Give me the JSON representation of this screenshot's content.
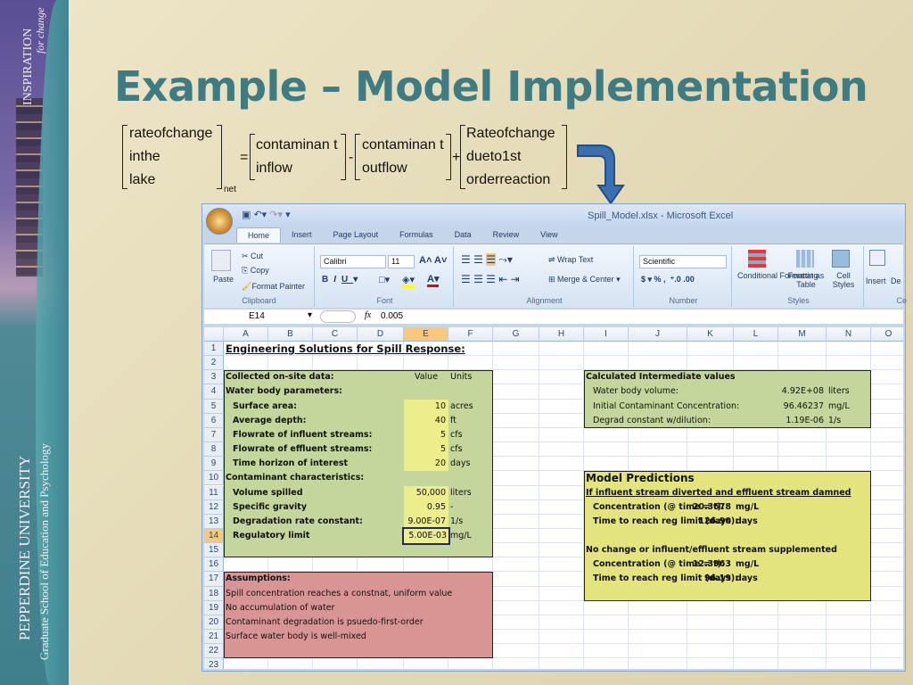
{
  "sidebar": {
    "tagline_main": "INSPIRATION",
    "tagline_sub": "for change",
    "university": "PEPPERDINE UNIVERSITY",
    "school": "Graduate School of Education and Psychology"
  },
  "slide": {
    "title": "Example – Model Implementation"
  },
  "equation": {
    "lhs": [
      "rateofchange",
      "inthe",
      "lake"
    ],
    "lhs_sub": "net",
    "equals": "=",
    "term1": [
      "contaminan t",
      "inflow"
    ],
    "minus": "-",
    "term2": [
      "contaminan t",
      "outflow"
    ],
    "plus": "+",
    "term3": [
      "Rateofchange",
      "dueto1st",
      "orderreaction"
    ]
  },
  "excel": {
    "window_title": "Spill_Model.xlsx - Microsoft Excel",
    "tabs": [
      "Home",
      "Insert",
      "Page Layout",
      "Formulas",
      "Data",
      "Review",
      "View"
    ],
    "ribbon": {
      "paste": "Paste",
      "cut": "Cut",
      "copy": "Copy",
      "format_painter": "Format Painter",
      "clipboard": "Clipboard",
      "font_name": "Calibri",
      "font_size": "11",
      "font": "Font",
      "wrap_text": "Wrap Text",
      "merge_center": "Merge & Center",
      "alignment": "Alignment",
      "number_format": "Scientific",
      "number": "Number",
      "conditional_formatting": "Conditional Formatting",
      "format_as_table": "Format as Table",
      "cell_styles": "Cell Styles",
      "styles": "Styles",
      "insert": "Insert",
      "delete": "De",
      "cells": "Ce"
    },
    "name_box": "E14",
    "formula": "0.005",
    "columns": [
      "A",
      "B",
      "C",
      "D",
      "E",
      "F",
      "G",
      "H",
      "I",
      "J",
      "K",
      "L",
      "M",
      "N",
      "O"
    ],
    "rows": [
      "1",
      "2",
      "3",
      "4",
      "5",
      "6",
      "7",
      "8",
      "9",
      "10",
      "11",
      "12",
      "13",
      "14",
      "15",
      "16",
      "17",
      "18",
      "19",
      "20",
      "21",
      "22",
      "23"
    ],
    "selected_cell": "E14",
    "colors": {
      "input_green": "#c3d69b",
      "input_yellow": "#eeed8c",
      "predictions": "#e4e47e",
      "assumptions": "#d99594"
    },
    "cells": [
      {
        "ref": "A1",
        "text": "Engineering Solutions for Spill Response:",
        "style": "title"
      },
      {
        "ref": "A3",
        "text": "Collected on-site data:",
        "style": "bold"
      },
      {
        "ref": "E3",
        "text": "Value",
        "style": "center"
      },
      {
        "ref": "F3",
        "text": "Units"
      },
      {
        "ref": "A4",
        "text": "Water body parameters:",
        "style": "bold"
      },
      {
        "ref": "A5",
        "text": "Surface area:",
        "style": "bold-indent"
      },
      {
        "ref": "E5",
        "text": "10",
        "style": "right"
      },
      {
        "ref": "F5",
        "text": "acres"
      },
      {
        "ref": "A6",
        "text": "Average depth:",
        "style": "bold-indent"
      },
      {
        "ref": "E6",
        "text": "40",
        "style": "right"
      },
      {
        "ref": "F6",
        "text": "ft"
      },
      {
        "ref": "A7",
        "text": "Flowrate of influent streams:",
        "style": "bold-indent"
      },
      {
        "ref": "E7",
        "text": "5",
        "style": "right"
      },
      {
        "ref": "F7",
        "text": "cfs"
      },
      {
        "ref": "A8",
        "text": "Flowrate of effluent streams:",
        "style": "bold-indent"
      },
      {
        "ref": "E8",
        "text": "5",
        "style": "right"
      },
      {
        "ref": "F8",
        "text": "cfs"
      },
      {
        "ref": "A9",
        "text": "Time horizon of interest",
        "style": "bold-indent"
      },
      {
        "ref": "E9",
        "text": "20",
        "style": "right"
      },
      {
        "ref": "F9",
        "text": "days"
      },
      {
        "ref": "A10",
        "text": "Contaminant characteristics:",
        "style": "bold"
      },
      {
        "ref": "A11",
        "text": "Volume spilled",
        "style": "bold-indent"
      },
      {
        "ref": "E11",
        "text": "50,000",
        "style": "right"
      },
      {
        "ref": "F11",
        "text": "liters"
      },
      {
        "ref": "A12",
        "text": "Specific gravity",
        "style": "bold-indent"
      },
      {
        "ref": "E12",
        "text": "0.95",
        "style": "right"
      },
      {
        "ref": "F12",
        "text": "-"
      },
      {
        "ref": "A13",
        "text": "Degradation rate constant:",
        "style": "bold-indent"
      },
      {
        "ref": "E13",
        "text": "9.00E-07",
        "style": "right"
      },
      {
        "ref": "F13",
        "text": "1/s"
      },
      {
        "ref": "A14",
        "text": "Regulatory limit",
        "style": "bold-indent"
      },
      {
        "ref": "E14",
        "text": "5.00E-03",
        "style": "right"
      },
      {
        "ref": "F14",
        "text": "mg/L"
      },
      {
        "ref": "A17",
        "text": "Assumptions:",
        "style": "bold"
      },
      {
        "ref": "A18",
        "text": "Spill concentration reaches a constnat, uniform value"
      },
      {
        "ref": "A19",
        "text": "No accumulation of water"
      },
      {
        "ref": "A20",
        "text": "Contaminant degradation is psuedo-first-order"
      },
      {
        "ref": "A21",
        "text": "Surface water body is well-mixed"
      },
      {
        "ref": "I3",
        "text": "Calculated Intermediate values",
        "style": "bold"
      },
      {
        "ref": "I4",
        "text": "Water body volume:",
        "style": "indent"
      },
      {
        "ref": "M4",
        "text": "4.92E+08",
        "style": "right"
      },
      {
        "ref": "N4",
        "text": "liters"
      },
      {
        "ref": "I5",
        "text": "Initial Contaminant Concentration:",
        "style": "indent"
      },
      {
        "ref": "M5",
        "text": "96.46237",
        "style": "right"
      },
      {
        "ref": "N5",
        "text": "mg/L"
      },
      {
        "ref": "I6",
        "text": "Degrad constant w/dilution:",
        "style": "indent"
      },
      {
        "ref": "M6",
        "text": "1.19E-06",
        "style": "right"
      },
      {
        "ref": "N6",
        "text": "1/s"
      },
      {
        "ref": "I10",
        "text": "Model Predictions",
        "style": "big"
      },
      {
        "ref": "I11",
        "text": "If influent stream diverted and effluent stream damned",
        "style": "bold-underline"
      },
      {
        "ref": "I12",
        "text": "Concentration (@ time = t):",
        "style": "bold-indent"
      },
      {
        "ref": "K12",
        "text": "20.3678",
        "style": "right-bold"
      },
      {
        "ref": "L12",
        "text": "mg/L",
        "style": "bold-left"
      },
      {
        "ref": "I13",
        "text": "Time to reach reg limit (days):",
        "style": "bold-indent"
      },
      {
        "ref": "K13",
        "text": "126.90",
        "style": "right-bold"
      },
      {
        "ref": "L13",
        "text": "days",
        "style": "bold-left"
      },
      {
        "ref": "I15",
        "text": "No change or influent/effluent stream supplemented",
        "style": "bold"
      },
      {
        "ref": "I16",
        "text": "Concentration (@ time = t):",
        "style": "bold-indent"
      },
      {
        "ref": "K16",
        "text": "12.3963",
        "style": "right-bold"
      },
      {
        "ref": "L16",
        "text": "mg/L",
        "style": "bold-left"
      },
      {
        "ref": "I17",
        "text": "Time to reach reg limit (days):",
        "style": "bold-indent"
      },
      {
        "ref": "K17",
        "text": "96.19",
        "style": "right-bold"
      },
      {
        "ref": "L17",
        "text": "days",
        "style": "bold-left"
      }
    ]
  }
}
